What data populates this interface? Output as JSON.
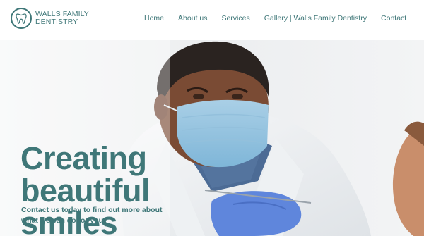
{
  "header": {
    "logo": {
      "line1": "WALLS FAMILY",
      "line2": "DENTISTRY",
      "icon": "tooth-logo-icon"
    },
    "nav": [
      {
        "label": "Home"
      },
      {
        "label": "About us"
      },
      {
        "label": "Services"
      },
      {
        "label": "Gallery | Walls Family Dentistry"
      },
      {
        "label": "Contact"
      }
    ]
  },
  "hero": {
    "headline_lines": [
      "Creating",
      "beautiful",
      "smiles"
    ],
    "subtext": "Contact us today to find out more about what we can do for you!"
  },
  "colors": {
    "brand": "#3f7778",
    "background": "#ffffff"
  }
}
